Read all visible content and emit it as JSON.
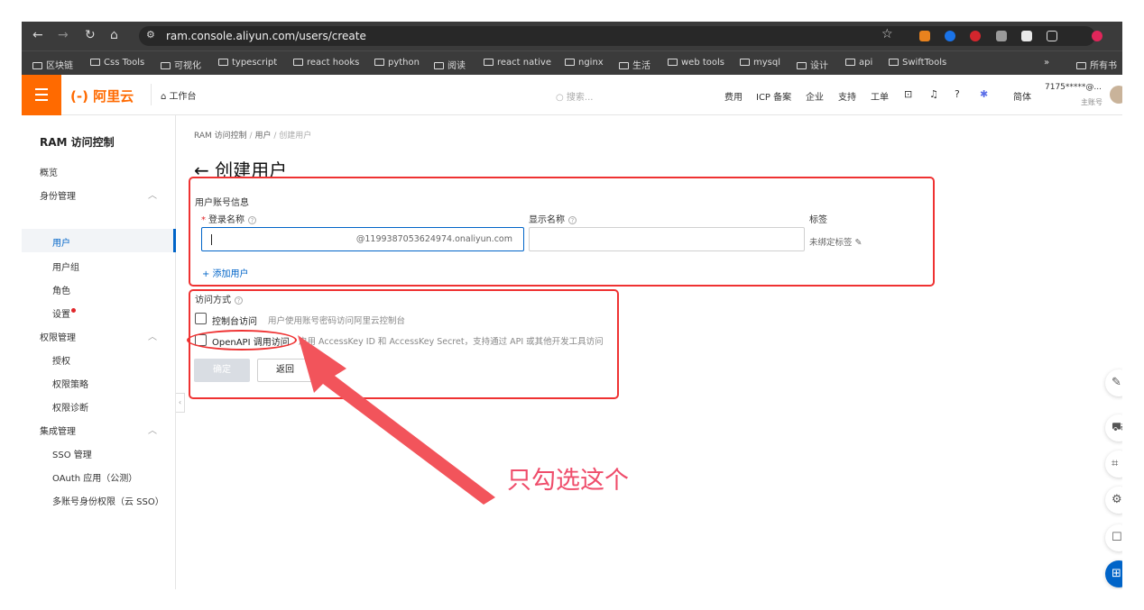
{
  "browser": {
    "url": "ram.console.aliyun.com/users/create",
    "bookmarks": [
      "区块链",
      "Css Tools",
      "可视化",
      "typescript",
      "react hooks",
      "python",
      "阅读",
      "react native",
      "nginx",
      "生活",
      "web tools",
      "mysql",
      "设计",
      "api",
      "SwiftTools"
    ],
    "more_bookmarks": "»",
    "all_bookmarks": "所有书"
  },
  "topbar": {
    "logo": "(-) 阿里云",
    "workbench": "工作台",
    "search_placeholder": "搜索...",
    "links": [
      "费用",
      "ICP 备案",
      "企业",
      "支持",
      "工单"
    ],
    "lang": "简体",
    "account": "7175*****@...",
    "account_role": "主账号"
  },
  "sidebar": {
    "title": "RAM 访问控制",
    "overview": "概览",
    "identity_group": "身份管理",
    "users": "用户",
    "user_groups": "用户组",
    "roles": "角色",
    "settings": "设置",
    "permission_group": "权限管理",
    "grants": "授权",
    "policies": "权限策略",
    "diagnosis": "权限诊断",
    "integration_group": "集成管理",
    "sso": "SSO 管理",
    "oauth": "OAuth 应用（公测）",
    "multi_account": "多账号身份权限（云 SSO）"
  },
  "main": {
    "breadcrumb": [
      "RAM 访问控制",
      "用户",
      "创建用户"
    ],
    "breadcrumb_sep": "/",
    "title": "创建用户",
    "account_info_label": "用户账号信息",
    "login_name_label": "登录名称",
    "required_mark": "*",
    "login_name_value": "",
    "login_name_suffix": "@1199387053624974.onaliyun.com",
    "display_name_label": "显示名称",
    "display_name_value": "",
    "tags_label": "标签",
    "tags_value": "未绑定标签",
    "add_user": "+ 添加用户",
    "access_mode_label": "访问方式",
    "console_access_label": "控制台访问",
    "console_access_desc": "用户使用账号密码访问阿里云控制台",
    "console_access_checked": false,
    "openapi_access_label": "OpenAPI 调用访问",
    "openapi_access_desc": "启用 AccessKey ID 和 AccessKey Secret，支持通过 API 或其他开发工具访问",
    "openapi_access_checked": false,
    "ok_button": "确定",
    "back_button": "返回"
  },
  "annotation": {
    "note": "只勾选这个",
    "color": "#ef3232"
  },
  "colors": {
    "brand": "#ff6a00",
    "primary": "#0064c8"
  }
}
